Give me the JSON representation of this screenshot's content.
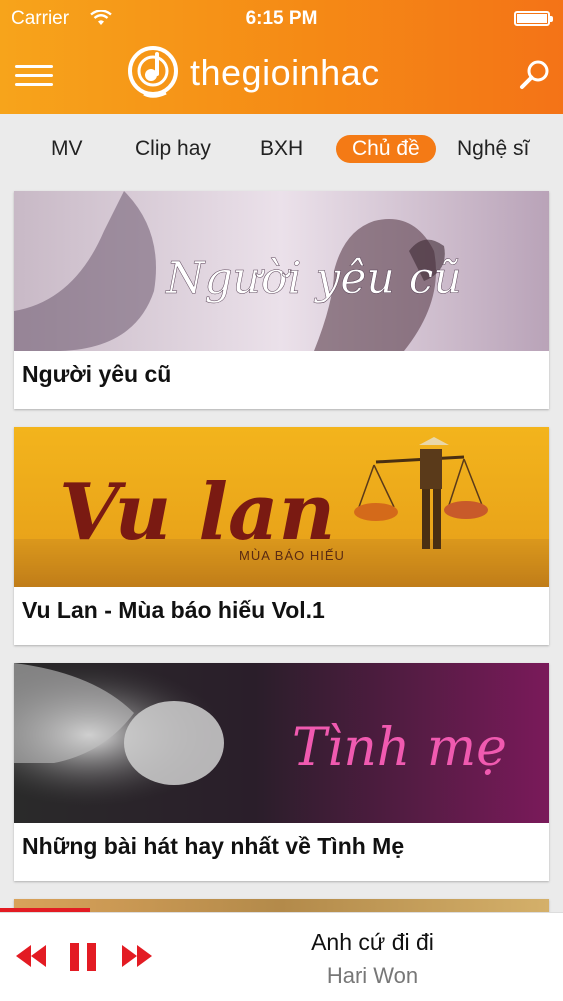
{
  "status": {
    "carrier": "Carrier",
    "time": "6:15 PM"
  },
  "header": {
    "app_name": "thegioinhac",
    "menu_icon": "hamburger-icon",
    "search_icon": "search-icon"
  },
  "tabs": [
    {
      "label": "MV"
    },
    {
      "label": "Clip hay"
    },
    {
      "label": "BXH"
    },
    {
      "label": "Chủ đề",
      "active": true
    },
    {
      "label": "Nghệ sĩ"
    }
  ],
  "topics": [
    {
      "title": "Người yêu cũ",
      "image_text": "Người yêu cũ"
    },
    {
      "title": "Vu Lan - Mùa báo hiếu Vol.1",
      "image_text": "Vu lan",
      "image_subtext": "MÙA BÁO HIẾU"
    },
    {
      "title": "Những bài hát hay nhất về Tình Mẹ",
      "image_text": "Tình mẹ"
    }
  ],
  "player": {
    "song": "Anh cứ đi đi",
    "artist": "Hari Won",
    "progress": 0.16,
    "accent": "#e31b23"
  },
  "colors": {
    "brand": "#f47a15",
    "header_start": "#f7a41b",
    "header_end": "#f47317"
  }
}
